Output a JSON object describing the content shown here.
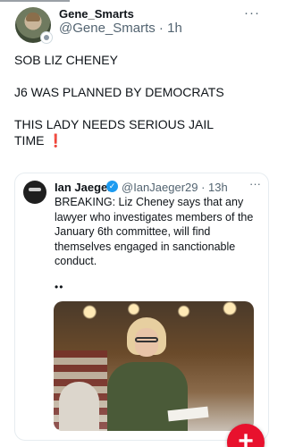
{
  "post": {
    "display_name": "Gene_Smarts",
    "handle_time": "@Gene_Smarts · 1h",
    "more": "···",
    "lines": [
      "SOB LIZ CHENEY",
      "J6 WAS PLANNED BY DEMOCRATS",
      "THIS LADY NEEDS SERIOUS JAIL TIME"
    ],
    "alert_glyph": "❗"
  },
  "quote": {
    "display_name": "Ian Jaeger",
    "verified_glyph": "✓",
    "handle_time": "@IanJaeger29 · 13h",
    "more": "···",
    "text": "BREAKING: Liz Cheney says that any lawyer who investigates members of the January 6th committee, will find themselves engaged in sanctionable conduct.",
    "extra": "••"
  },
  "fab": {
    "glyph": "+"
  },
  "colors": {
    "accent": "#e8112d",
    "verified": "#1d9bf0",
    "muted": "#536471"
  }
}
